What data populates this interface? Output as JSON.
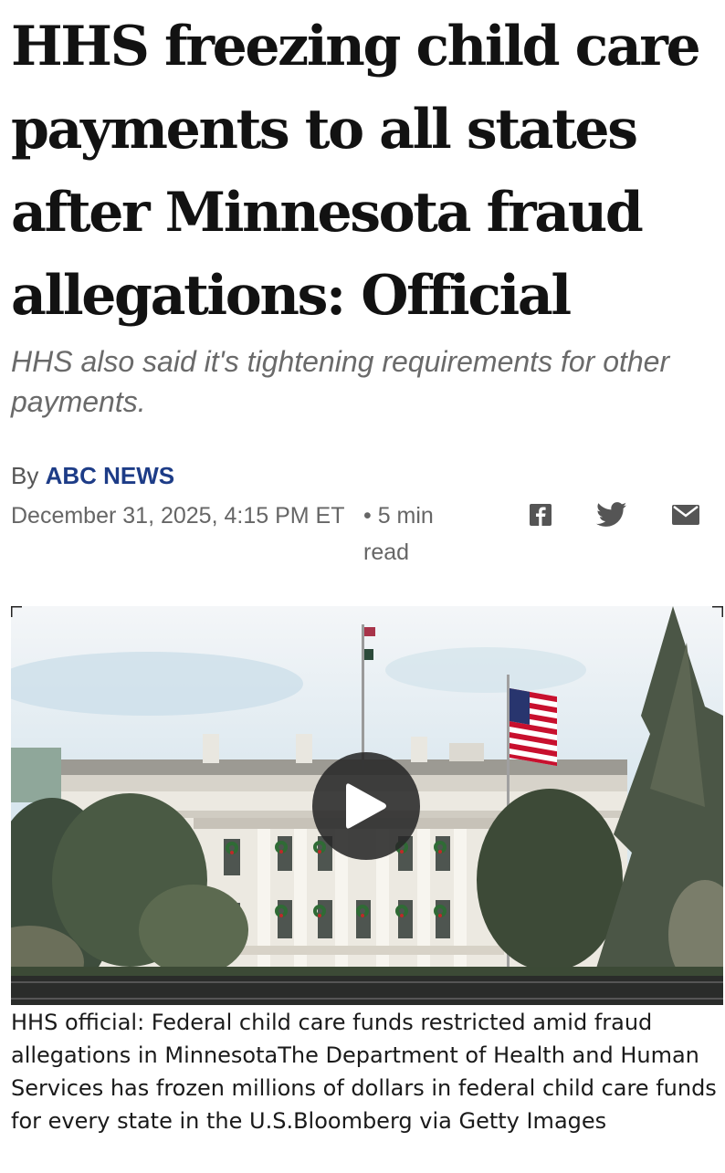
{
  "article": {
    "headline": "HHS freezing child care payments to all states after Minnesota fraud allegations: Official",
    "subheadline": "HHS also said it's tightening requirements for other payments.",
    "byline_prefix": "By",
    "author": "ABC NEWS",
    "date": "December 31, 2025, 4:15 PM ET",
    "read_time": "• 5 min read"
  },
  "share": {
    "icons": [
      "facebook-icon",
      "twitter-icon",
      "email-icon"
    ]
  },
  "video": {
    "caption": "HHS official: Federal child care funds restricted amid fraud allegations in MinnesotaThe Department of Health and Human Services has frozen millions of dollars in federal child care funds for every state in the U.S.Bloomberg via Getty Images"
  },
  "colors": {
    "author": "#1d3c87",
    "headline": "#121212",
    "meta": "#666666",
    "play_button": "#282828"
  }
}
